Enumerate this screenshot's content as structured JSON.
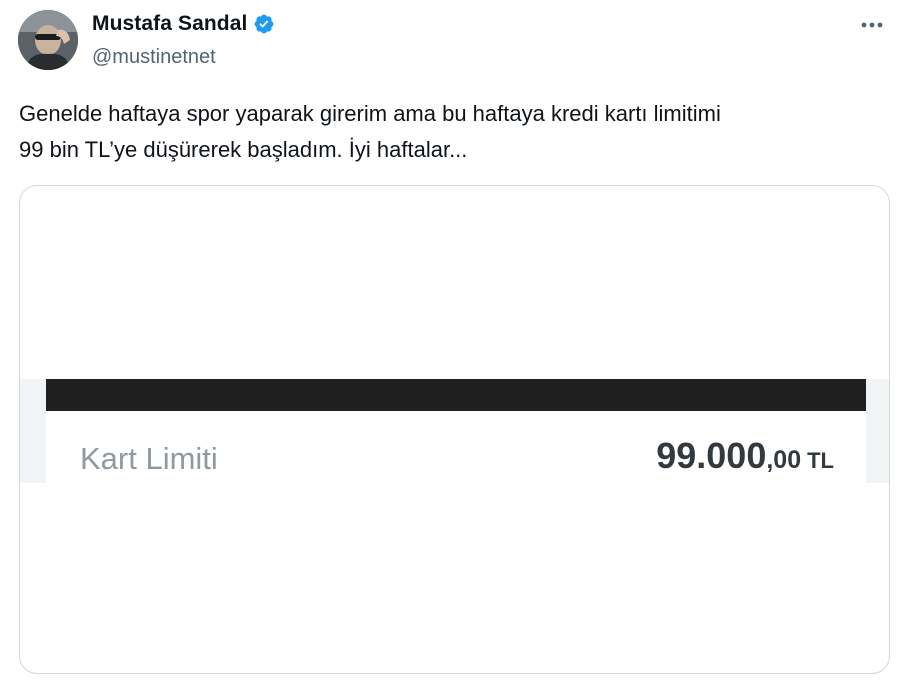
{
  "author": {
    "display_name": "Mustafa Sandal",
    "handle": "@mustinetnet",
    "avatar_icon": "profile-photo",
    "verified_icon": "verified-badge-icon",
    "verified_color": "#1d9bf0"
  },
  "header": {
    "more_icon": "more-options-icon"
  },
  "tweet": {
    "text": "Genelde haftaya spor yaparak girerim ama bu haftaya kredi kartı limitimi\n99 bin TL’ye düşürerek başladım. İyi haftalar..."
  },
  "media": {
    "label": "Kart Limiti",
    "amount_main": "99.000",
    "amount_decimal": ",00",
    "currency": "TL"
  }
}
